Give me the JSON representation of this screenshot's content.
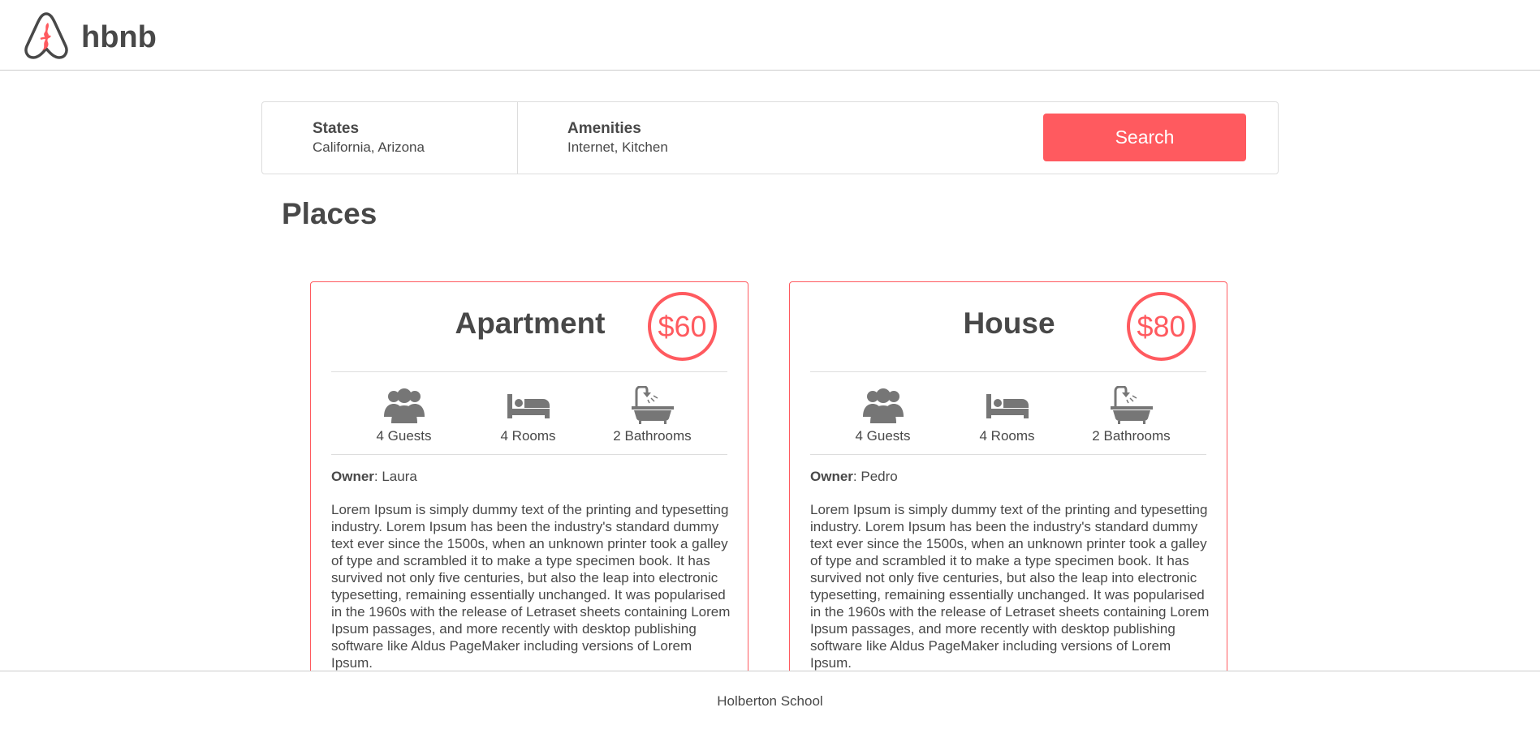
{
  "header": {
    "logo_text": "hbnb",
    "logo_icon": "airbnb-logo-icon"
  },
  "filters": {
    "states": {
      "title": "States",
      "value": "California, Arizona"
    },
    "amenities": {
      "title": "Amenities",
      "value": "Internet, Kitchen"
    },
    "search_label": "Search"
  },
  "places": {
    "title": "Places",
    "items": [
      {
        "name": "Apartment",
        "price": "$60",
        "guests": "4 Guests",
        "rooms": "4 Rooms",
        "bathrooms": "2 Bathrooms",
        "owner_label": "Owner",
        "owner_name": ": Laura",
        "description": "Lorem Ipsum is simply dummy text of the printing and typesetting industry. Lorem Ipsum has been the industry's standard dummy text ever since the 1500s, when an unknown printer took a galley of type and scrambled it to make a type specimen book. It has survived not only five centuries, but also the leap into electronic typesetting, remaining essentially unchanged. It was popularised in the 1960s with the release of Letraset sheets containing Lorem Ipsum passages, and more recently with desktop publishing software like Aldus PageMaker including versions of Lorem Ipsum."
      },
      {
        "name": "House",
        "price": "$80",
        "guests": "4 Guests",
        "rooms": "4 Rooms",
        "bathrooms": "2 Bathrooms",
        "owner_label": "Owner",
        "owner_name": ": Pedro",
        "description": "Lorem Ipsum is simply dummy text of the printing and typesetting industry. Lorem Ipsum has been the industry's standard dummy text ever since the 1500s, when an unknown printer took a galley of type and scrambled it to make a type specimen book. It has survived not only five centuries, but also the leap into electronic typesetting, remaining essentially unchanged. It was popularised in the 1960s with the release of Letraset sheets containing Lorem Ipsum passages, and more recently with desktop publishing software like Aldus PageMaker including versions of Lorem Ipsum."
      }
    ]
  },
  "footer": {
    "text": "Holberton School"
  },
  "colors": {
    "accent": "#ff5a5f",
    "text": "#484848",
    "border": "#dddddd"
  },
  "icons": {
    "guests": "guests-icon",
    "rooms": "bed-icon",
    "bathrooms": "bathtub-icon"
  }
}
